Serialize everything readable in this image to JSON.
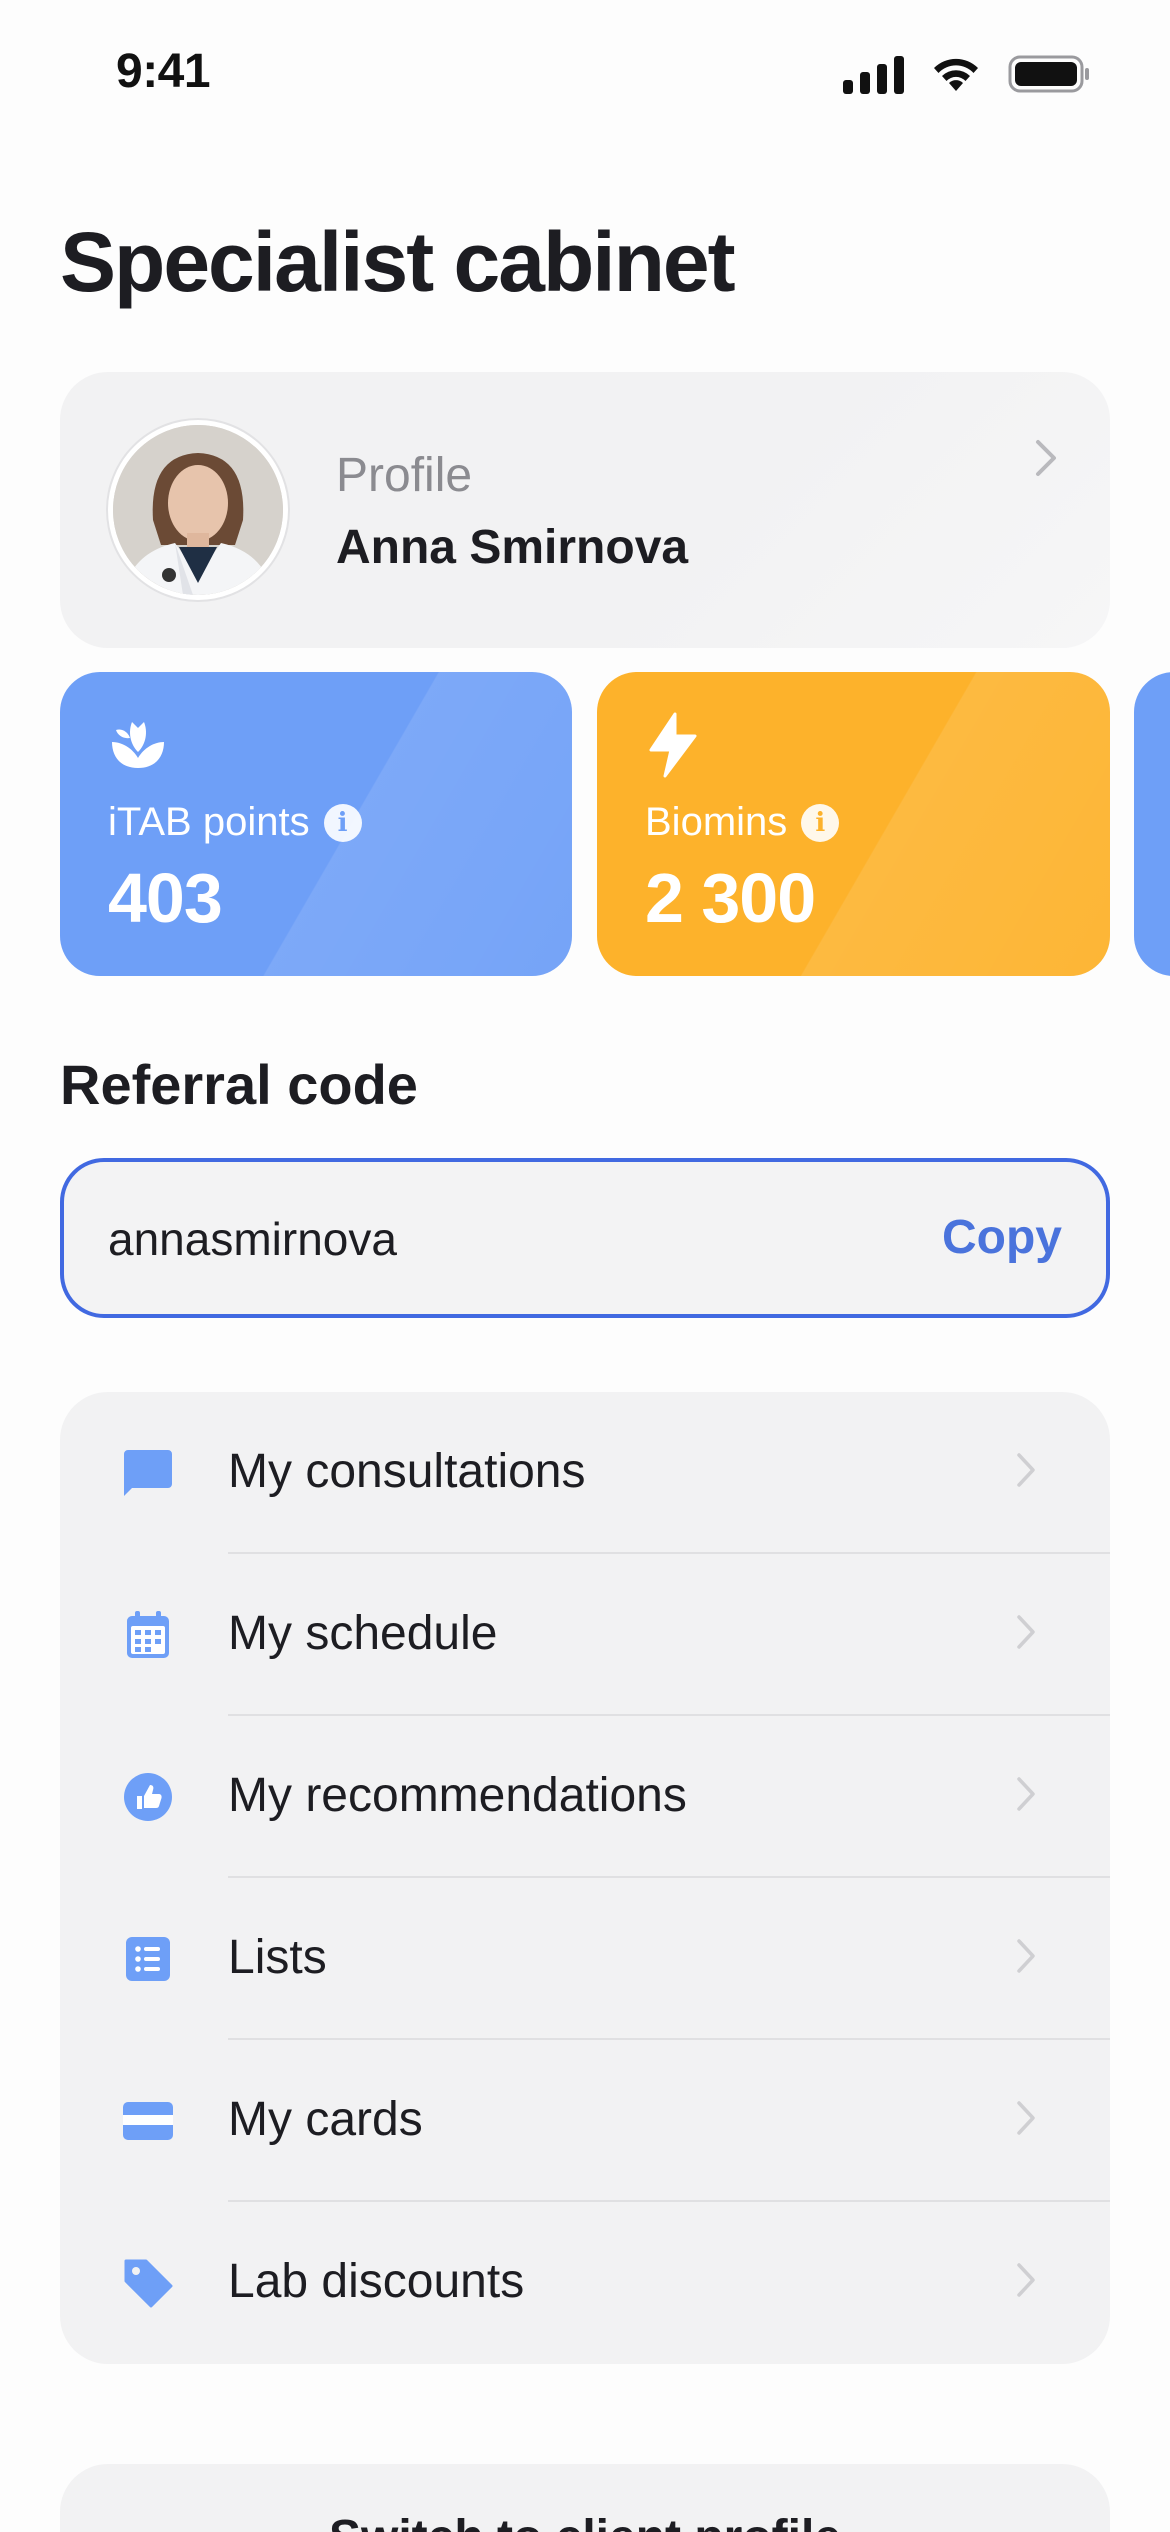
{
  "status_bar": {
    "time": "9:41"
  },
  "page_title": "Specialist cabinet",
  "profile": {
    "caption": "Profile",
    "name": "Anna Smirnova"
  },
  "stats": [
    {
      "label": "iTAB points",
      "value": "403",
      "color": "#6e9ff7",
      "icon": "itab-leaf-icon"
    },
    {
      "label": "Biomins",
      "value": "2 300",
      "color": "#fdb22b",
      "icon": "lightning-icon"
    }
  ],
  "referral": {
    "title": "Referral code",
    "code": "annasmirnova",
    "copy_label": "Copy"
  },
  "menu": {
    "items": [
      {
        "label": "My consultations",
        "icon": "chat-bubble-icon"
      },
      {
        "label": "My schedule",
        "icon": "calendar-icon"
      },
      {
        "label": "My recommendations",
        "icon": "thumbs-up-icon"
      },
      {
        "label": "Lists",
        "icon": "list-icon"
      },
      {
        "label": "My cards",
        "icon": "credit-card-icon"
      },
      {
        "label": "Lab discounts",
        "icon": "tag-icon"
      }
    ]
  },
  "bottom_action": {
    "label": "Switch to client profile"
  },
  "colors": {
    "accent": "#4169e1",
    "icon_blue": "#6e9ff7",
    "orange": "#fdb22b"
  }
}
